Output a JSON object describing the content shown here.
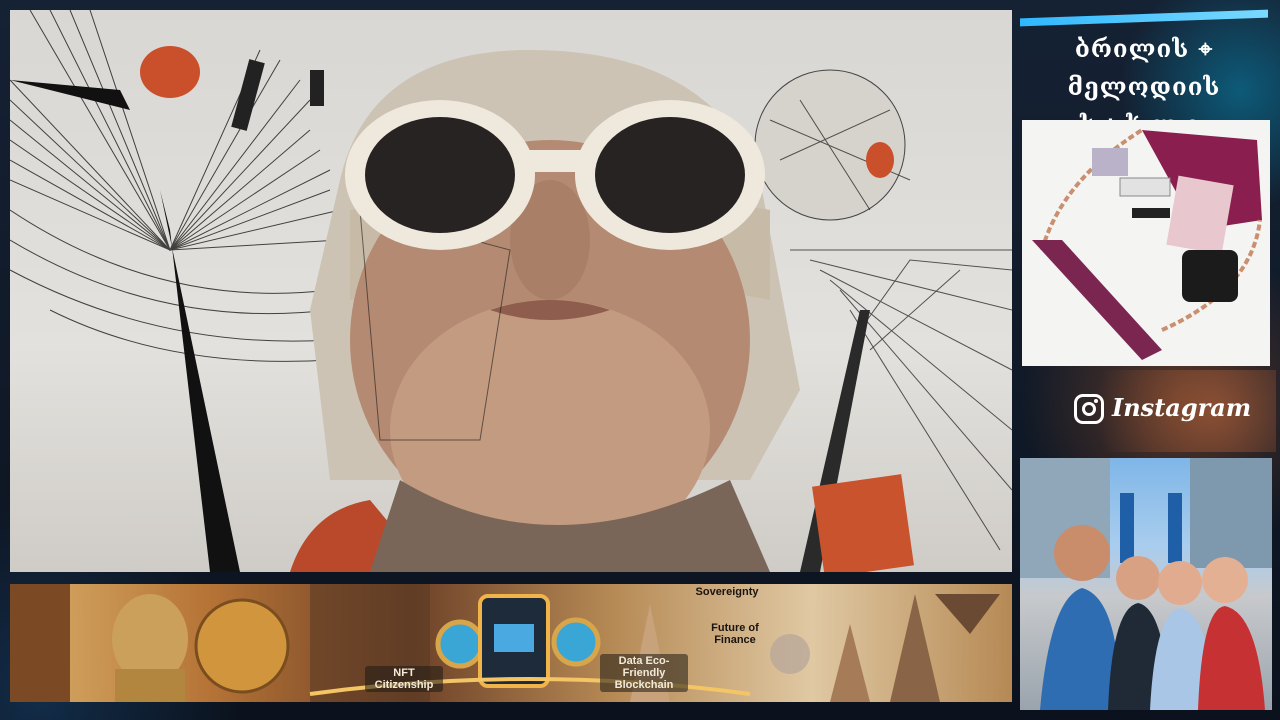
{
  "stream": {
    "brand_title_line1": "ბრილის ⌖ მელოდიის",
    "brand_title_line2": "სახლი",
    "instagram_label": "Instagram"
  },
  "banner": {
    "label_top": "Sovereignty",
    "label_future": "Future of Finance",
    "label_nft": "NFT Citizenship",
    "label_data": "Data Eco-Friendly Blockchain"
  },
  "colors": {
    "brand_bar": "#2fb8ff",
    "instagram_text": "#ffffff",
    "banner_gold": "#d9a24a"
  },
  "icons": {
    "instagram": "instagram-icon"
  }
}
